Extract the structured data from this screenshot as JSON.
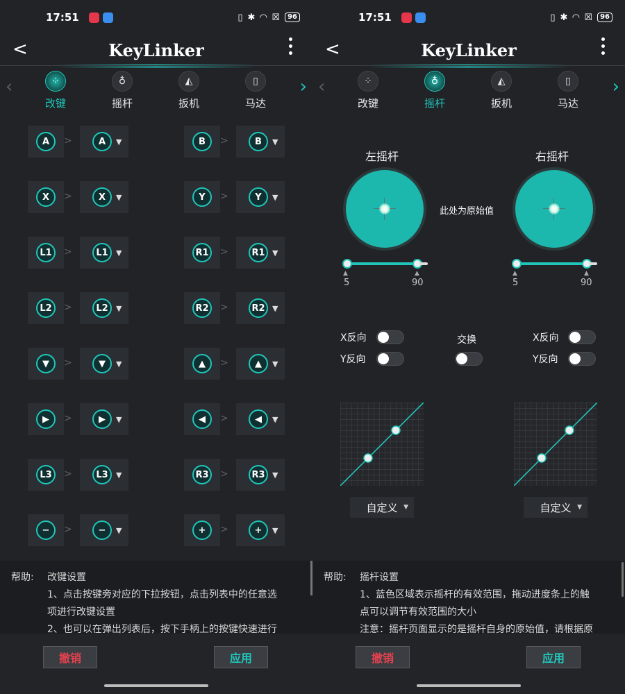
{
  "colors": {
    "accent": "#21c6ba",
    "cancel": "#e6414f",
    "background": "#212327"
  },
  "left": {
    "status": {
      "time": "17:51",
      "battery": "96"
    },
    "header": {
      "title": "KeyLinker"
    },
    "tabs": [
      {
        "label": "改键",
        "icon": "gamepad-icon"
      },
      {
        "label": "摇杆",
        "icon": "joystick-icon"
      },
      {
        "label": "扳机",
        "icon": "trigger-icon"
      },
      {
        "label": "马达",
        "icon": "vibration-motor-icon"
      }
    ],
    "mappings": [
      [
        {
          "src": "A",
          "dst": "A"
        },
        {
          "src": "B",
          "dst": "B"
        }
      ],
      [
        {
          "src": "X",
          "dst": "X"
        },
        {
          "src": "Y",
          "dst": "Y"
        }
      ],
      [
        {
          "src": "L1",
          "dst": "L1"
        },
        {
          "src": "R1",
          "dst": "R1"
        }
      ],
      [
        {
          "src": "L2",
          "dst": "L2"
        },
        {
          "src": "R2",
          "dst": "R2"
        }
      ],
      [
        {
          "src": "▼",
          "dst": "▼"
        },
        {
          "src": "▲",
          "dst": "▲"
        }
      ],
      [
        {
          "src": "▶",
          "dst": "▶"
        },
        {
          "src": "◀",
          "dst": "◀"
        }
      ],
      [
        {
          "src": "L3",
          "dst": "L3"
        },
        {
          "src": "R3",
          "dst": "R3"
        }
      ],
      [
        {
          "src": "−",
          "dst": "−"
        },
        {
          "src": "+",
          "dst": "+"
        }
      ]
    ],
    "help": {
      "key": "帮助:",
      "title": "改键设置",
      "lines": [
        "1、点击按键旁对应的下拉按钮，点击列表中的任意选",
        "项进行改键设置",
        "2、也可以在弹出列表后，按下手柄上的按键快速进行"
      ]
    },
    "footer": {
      "cancel": "撤销",
      "apply": "应用"
    }
  },
  "right": {
    "status": {
      "time": "17:51",
      "battery": "96"
    },
    "header": {
      "title": "KeyLinker"
    },
    "tabs": [
      {
        "label": "改键",
        "icon": "gamepad-icon"
      },
      {
        "label": "摇杆",
        "icon": "joystick-icon"
      },
      {
        "label": "扳机",
        "icon": "trigger-icon"
      },
      {
        "label": "马达",
        "icon": "vibration-motor-icon"
      }
    ],
    "sticks": {
      "left_title": "左摇杆",
      "right_title": "右摇杆",
      "center_note": "此处为原始值",
      "left_range": {
        "min": "5",
        "max": "90"
      },
      "right_range": {
        "min": "5",
        "max": "90"
      }
    },
    "toggles": {
      "x_invert": "X反向",
      "y_invert": "Y反向",
      "swap": "交换"
    },
    "curve_preset": "自定义",
    "help": {
      "key": "帮助:",
      "title": "摇杆设置",
      "lines": [
        "1、蓝色区域表示摇杆的有效范围，拖动进度条上的触",
        "点可以调节有效范围的大小",
        "注意：摇杆页面显示的是摇杆自身的原始值，请根据原"
      ]
    },
    "footer": {
      "cancel": "撤销",
      "apply": "应用"
    }
  }
}
